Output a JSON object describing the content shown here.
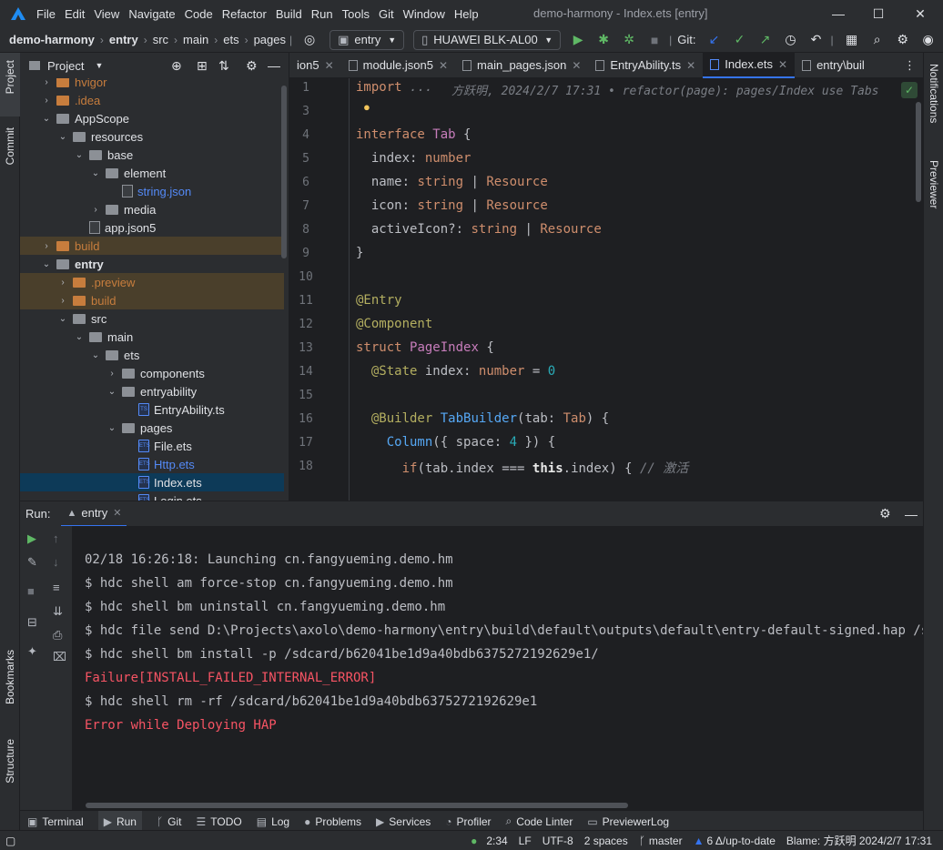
{
  "title_bar": {
    "menus": [
      "File",
      "Edit",
      "View",
      "Navigate",
      "Code",
      "Refactor",
      "Build",
      "Run",
      "Tools",
      "Git",
      "Window",
      "Help"
    ],
    "window_title": "demo-harmony - Index.ets [entry]"
  },
  "nav_bar": {
    "breadcrumbs": [
      "demo-harmony",
      "entry",
      "src",
      "main",
      "ets",
      "pages"
    ],
    "run_config": "entry",
    "device": "HUAWEI BLK-AL00",
    "git_label": "Git:"
  },
  "left_stripe": {
    "project": "Project",
    "commit": "Commit",
    "bookmarks": "Bookmarks",
    "structure": "Structure"
  },
  "right_stripe": {
    "notifications": "Notifications",
    "previewer": "Previewer"
  },
  "project_panel": {
    "title": "Project",
    "tree": [
      {
        "label": "hvigor",
        "kind": "folder",
        "level": 1,
        "state": "collapsed",
        "color": "#c77d3d"
      },
      {
        "label": ".idea",
        "kind": "folder",
        "level": 1,
        "state": "collapsed",
        "color": "#c77d3d"
      },
      {
        "label": "AppScope",
        "kind": "folder",
        "level": 1,
        "state": "expanded",
        "color": "#dfe1e5"
      },
      {
        "label": "resources",
        "kind": "folder",
        "level": 2,
        "state": "expanded",
        "color": "#dfe1e5"
      },
      {
        "label": "base",
        "kind": "folder",
        "level": 3,
        "state": "expanded",
        "color": "#dfe1e5"
      },
      {
        "label": "element",
        "kind": "folder",
        "level": 4,
        "state": "expanded",
        "color": "#dfe1e5"
      },
      {
        "label": "string.json",
        "kind": "json",
        "level": 5,
        "state": "none",
        "color": "#548af7"
      },
      {
        "label": "media",
        "kind": "folder",
        "level": 4,
        "state": "collapsed",
        "color": "#dfe1e5"
      },
      {
        "label": "app.json5",
        "kind": "json",
        "level": 3,
        "state": "none",
        "color": "#dfe1e5"
      },
      {
        "label": "build",
        "kind": "folder",
        "level": 1,
        "state": "collapsed",
        "color": "#c77d3d",
        "highlight": true
      },
      {
        "label": "entry",
        "kind": "folder",
        "level": 1,
        "state": "expanded",
        "color": "#dfe1e5",
        "bold": true
      },
      {
        "label": ".preview",
        "kind": "folder",
        "level": 2,
        "state": "collapsed",
        "color": "#c77d3d",
        "highlight": true
      },
      {
        "label": "build",
        "kind": "folder",
        "level": 2,
        "state": "collapsed",
        "color": "#c77d3d",
        "highlight": true
      },
      {
        "label": "src",
        "kind": "folder",
        "level": 2,
        "state": "expanded",
        "color": "#dfe1e5"
      },
      {
        "label": "main",
        "kind": "folder",
        "level": 3,
        "state": "expanded",
        "color": "#dfe1e5"
      },
      {
        "label": "ets",
        "kind": "folder",
        "level": 4,
        "state": "expanded",
        "color": "#dfe1e5"
      },
      {
        "label": "components",
        "kind": "folder",
        "level": 5,
        "state": "collapsed",
        "color": "#dfe1e5"
      },
      {
        "label": "entryability",
        "kind": "folder",
        "level": 5,
        "state": "expanded",
        "color": "#dfe1e5"
      },
      {
        "label": "EntryAbility.ts",
        "kind": "ts",
        "level": 6,
        "state": "none",
        "color": "#dfe1e5"
      },
      {
        "label": "pages",
        "kind": "folder",
        "level": 5,
        "state": "expanded",
        "color": "#dfe1e5"
      },
      {
        "label": "File.ets",
        "kind": "ets",
        "level": 6,
        "state": "none",
        "color": "#dfe1e5"
      },
      {
        "label": "Http.ets",
        "kind": "ets",
        "level": 6,
        "state": "none",
        "color": "#548af7"
      },
      {
        "label": "Index.ets",
        "kind": "ets",
        "level": 6,
        "state": "none",
        "color": "#dfe1e5",
        "selected": true
      },
      {
        "label": "Login.ets",
        "kind": "ets",
        "level": 6,
        "state": "none",
        "color": "#dfe1e5"
      }
    ]
  },
  "editor_tabs": [
    {
      "label": "ion5",
      "active": false
    },
    {
      "label": "module.json5",
      "active": false
    },
    {
      "label": "main_pages.json",
      "active": false
    },
    {
      "label": "EntryAbility.ts",
      "active": false
    },
    {
      "label": "Index.ets",
      "active": true
    },
    {
      "label": "entry\\buil",
      "active": false
    }
  ],
  "editor": {
    "inlay_blame": "方跃明, 2024/2/7 17:31 • refactor(page): pages/Index use Tabs",
    "lines": [
      {
        "n": "1",
        "html": "<span class='kw'>import</span> <span class='cm'>...</span>"
      },
      {
        "n": "3",
        "html": ""
      },
      {
        "n": "4",
        "html": "<span class='kw'>interface</span> <span class='ty'>Tab</span> <span class='id'>{</span>"
      },
      {
        "n": "5",
        "html": "  <span class='id'>index</span>: <span class='kw'>number</span>"
      },
      {
        "n": "6",
        "html": "  <span class='id'>name</span>: <span class='kw'>string</span> | <span class='kw'>Resource</span>"
      },
      {
        "n": "7",
        "html": "  <span class='id'>icon</span>: <span class='kw'>string</span> | <span class='kw'>Resource</span>"
      },
      {
        "n": "8",
        "html": "  <span class='id'>activeIcon?</span>: <span class='kw'>string</span> | <span class='kw'>Resource</span>"
      },
      {
        "n": "9",
        "html": "<span class='id'>}</span>"
      },
      {
        "n": "10",
        "html": ""
      },
      {
        "n": "11",
        "html": "<span class='an'>@Entry</span>"
      },
      {
        "n": "12",
        "html": "<span class='an'>@Component</span>"
      },
      {
        "n": "13",
        "html": "<span class='kw'>struct</span> <span class='ty'>PageIndex</span> <span class='id'>{</span>"
      },
      {
        "n": "14",
        "html": "  <span class='an'>@State</span> <span class='id'>index</span>: <span class='kw'>number</span> = <span class='nu'>0</span>"
      },
      {
        "n": "15",
        "html": ""
      },
      {
        "n": "16",
        "html": "  <span class='an'>@Builder</span> <span class='fn'>TabBuilder</span>(<span class='id'>tab</span>: <span class='kw'>Tab</span>) {"
      },
      {
        "n": "17",
        "html": "    <span class='fn'>Column</span>({ <span class='id'>space</span>: <span class='nu'>4</span> }) {"
      },
      {
        "n": "18",
        "html": "      <span class='kw'>if</span>(<span class='id'>tab</span>.<span class='id'>index</span> === <span class='wk'>this</span>.<span class='id'>index</span>) { <span class='cm'>// 激活</span>"
      }
    ]
  },
  "run_panel": {
    "label": "Run:",
    "tab": "entry",
    "console": [
      {
        "text": "02/18 16:26:18: Launching cn.fangyueming.demo.hm",
        "error": false
      },
      {
        "text": "$ hdc shell am force-stop cn.fangyueming.demo.hm",
        "error": false
      },
      {
        "text": "$ hdc shell bm uninstall cn.fangyueming.demo.hm",
        "error": false
      },
      {
        "text": "$ hdc file send D:\\Projects\\axolo\\demo-harmony\\entry\\build\\default\\outputs\\default\\entry-default-signed.hap /sdcard",
        "error": false
      },
      {
        "text": "$ hdc shell bm install -p /sdcard/b62041be1d9a40bdb6375272192629e1/",
        "error": false
      },
      {
        "text": "Failure[INSTALL_FAILED_INTERNAL_ERROR]",
        "error": true
      },
      {
        "text": "$ hdc shell rm -rf /sdcard/b62041be1d9a40bdb6375272192629e1",
        "error": false
      },
      {
        "text": "Error while Deploying HAP",
        "error": true
      }
    ]
  },
  "tool_windows": [
    {
      "label": "Terminal",
      "icon": "terminal-icon",
      "glyph": "▣",
      "active": false
    },
    {
      "label": "Run",
      "icon": "run-icon",
      "glyph": "▶",
      "active": true
    },
    {
      "label": "Git",
      "icon": "git-icon",
      "glyph": "ᚴ",
      "active": false
    },
    {
      "label": "TODO",
      "icon": "todo-icon",
      "glyph": "☰",
      "active": false
    },
    {
      "label": "Log",
      "icon": "log-icon",
      "glyph": "▤",
      "active": false
    },
    {
      "label": "Problems",
      "icon": "problems-icon",
      "glyph": "●",
      "active": false
    },
    {
      "label": "Services",
      "icon": "services-icon",
      "glyph": "▶",
      "active": false
    },
    {
      "label": "Profiler",
      "icon": "profiler-icon",
      "glyph": "◔",
      "active": false
    },
    {
      "label": "Code Linter",
      "icon": "code-linter-icon",
      "glyph": "⌕",
      "active": false
    },
    {
      "label": "PreviewerLog",
      "icon": "previewer-log-icon",
      "glyph": "▭",
      "active": false
    }
  ],
  "status_bar": {
    "position": "2:34",
    "line_sep": "LF",
    "encoding": "UTF-8",
    "indent": "2 spaces",
    "branch": "master",
    "vcs_state": "6 Δ/up-to-date",
    "blame": "Blame: 方跃明 2024/2/7 17:31"
  },
  "colors": {
    "accent": "#3574f0",
    "error": "#f75464",
    "highlight_row": "#4a3f2b",
    "selected_row": "#0d3a58",
    "run_green": "#5fb865"
  }
}
